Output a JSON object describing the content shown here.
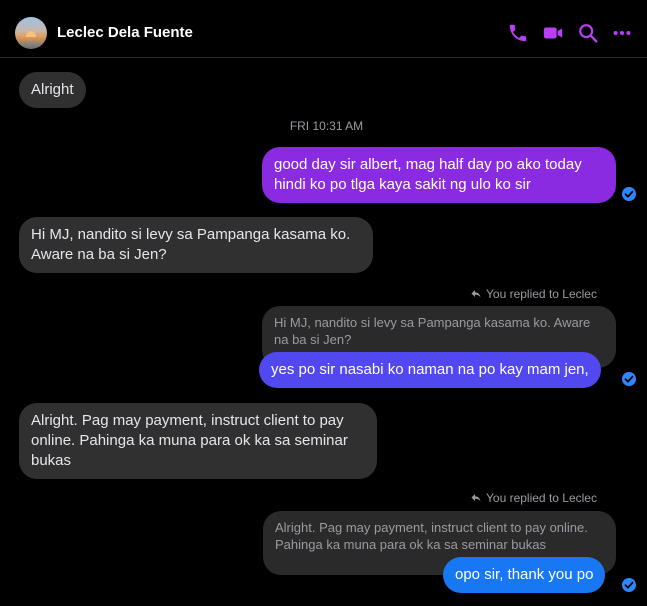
{
  "header": {
    "contact_name": "Leclec Dela Fuente",
    "actions": [
      "phone-icon",
      "video-icon",
      "search-icon",
      "more-icon"
    ],
    "accent_color": "#b83ff5"
  },
  "conversation": {
    "timestamp": "FRI 10:31 AM",
    "messages": [
      {
        "text": "Alright"
      },
      {
        "text": "good day sir albert, mag half day po ako today hindi ko po tlga kaya sakit ng ulo ko sir",
        "color": "#8a2be2"
      },
      {
        "text": "Hi MJ, nandito si levy sa Pampanga kasama ko. Aware na ba si Jen?"
      },
      {
        "replied_label": "You replied to Leclec",
        "quoted": "Hi MJ, nandito si levy sa Pampanga kasama ko. Aware na ba si Jen?",
        "text": "yes po sir nasabi ko naman na po kay mam jen,",
        "color": "#5148f0"
      },
      {
        "text": "Alright. Pag may payment, instruct client to pay online. Pahinga ka muna para ok ka sa seminar bukas"
      },
      {
        "replied_label": "You replied to Leclec",
        "quoted": "Alright. Pag may payment, instruct client to pay online. Pahinga ka muna para ok ka sa seminar bukas",
        "text": "opo sir, thank you po",
        "color": "#1877f2"
      }
    ]
  },
  "colors": {
    "incoming_bubble": "#303030",
    "quote_bubble": "#2a2a2a",
    "seen_badge": "#2d88ff"
  }
}
